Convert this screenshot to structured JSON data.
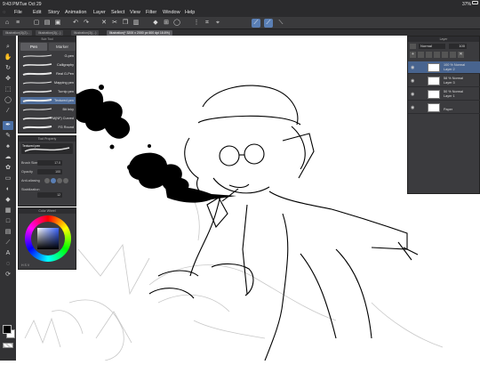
{
  "status": {
    "time": "9:43 PM",
    "date": "Tue Oct 29",
    "battery": "37%"
  },
  "menu": [
    "File",
    "Edit",
    "Story",
    "Animation",
    "Layer",
    "Select",
    "View",
    "Filter",
    "Window",
    "Help"
  ],
  "tabs": [
    "Illustration(3)(2)...",
    "Illustration(3)(...)",
    "Illustration(3)(...)",
    "Illustration(* 3200 x 2000 px 600 dpi 16.6%)"
  ],
  "brush_panel": {
    "title": "Sub Tool",
    "tab_pen": "Pen",
    "tab_marker": "Marker",
    "brushes": [
      "G-pen",
      "Calligraphy",
      "Real G-Pen",
      "Mapping pen",
      "Turnip pen",
      "Textured pen",
      "Bit Inky",
      "FM(NF) Curved",
      "FG Round"
    ],
    "selected_index": 5
  },
  "tool_props": {
    "title": "Tool Property",
    "brush_name": "Textured pen",
    "brush_size_label": "Brush Size",
    "brush_size_value": "17.0",
    "opacity_label": "Opacity",
    "opacity_value": "100",
    "antialias_label": "Anti-aliasing",
    "stabilization_label": "Stabilization",
    "stabilization_value": "12"
  },
  "color_panel": {
    "title": "Color Wheel",
    "h": "H",
    "s": "S",
    "v": "V"
  },
  "layer_panel": {
    "title": "Layer",
    "blend_mode": "Normal",
    "opacity": "100",
    "layers": [
      {
        "meta": "100 % Normal",
        "name": "Layer 2",
        "visible": true
      },
      {
        "meta": "58 % Normal",
        "name": "Layer 3",
        "visible": true
      },
      {
        "meta": "50 % Normal",
        "name": "Layer 1",
        "visible": true
      },
      {
        "meta": "",
        "name": "Paper",
        "visible": true
      }
    ]
  },
  "colors": {
    "main": "#000000",
    "sub": "#ffffff",
    "accent": "#4a6fa5"
  }
}
